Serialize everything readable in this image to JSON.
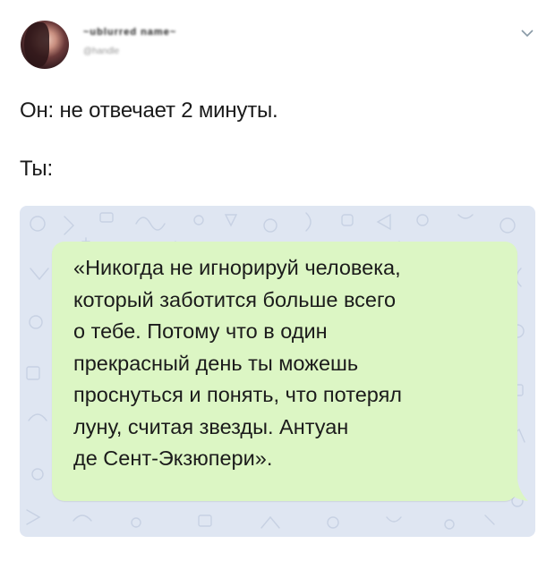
{
  "post": {
    "author_name": "~ublurred name~",
    "author_handle": "@handle",
    "line1": "Он: не отвечает 2 минуты.",
    "line2": "Ты:",
    "message": "«Никогда не игнорируй человека,\nкоторый заботится больше всего\nо тебе. Потому что в один\nпрекрасный день ты можешь\nпроснуться и понять, что потерял\nлуну, считая звезды. Антуан\nде Сент-Экзюпери»."
  },
  "icons": {
    "avatar": "avatar",
    "menu": "chevron-down-icon"
  },
  "colors": {
    "bubble": "#dcf6c4",
    "chat_background": "#dfe6f2",
    "text": "#1b1b1b"
  }
}
